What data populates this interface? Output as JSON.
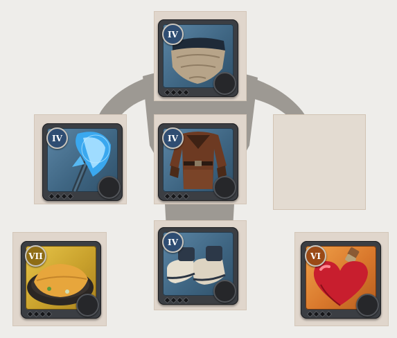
{
  "equipment": {
    "head": {
      "tier": "IV",
      "item": "cowl",
      "icon": "cowl-icon",
      "frame_color": "#4a7396"
    },
    "mainhand": {
      "tier": "IV",
      "item": "frost staff",
      "icon": "frost-staff-icon",
      "frame_color": "#4a7396"
    },
    "armor": {
      "tier": "IV",
      "item": "leather jacket",
      "icon": "leather-jacket-icon",
      "frame_color": "#4a7396"
    },
    "offhand": {
      "tier": null,
      "item": null,
      "icon": "empty-slot"
    },
    "food": {
      "tier": "VII",
      "item": "omelette",
      "icon": "omelette-icon",
      "frame_color": "#d4ab35"
    },
    "shoes": {
      "tier": "IV",
      "item": "shoes",
      "icon": "shoes-icon",
      "frame_color": "#4a7396"
    },
    "potion": {
      "tier": "VI",
      "item": "healing potion",
      "icon": "heart-potion-icon",
      "frame_color": "#e2873a"
    }
  },
  "colors": {
    "background": "#eeedea",
    "slot_background": "#e0d6cc",
    "silhouette": "#8d8880"
  }
}
